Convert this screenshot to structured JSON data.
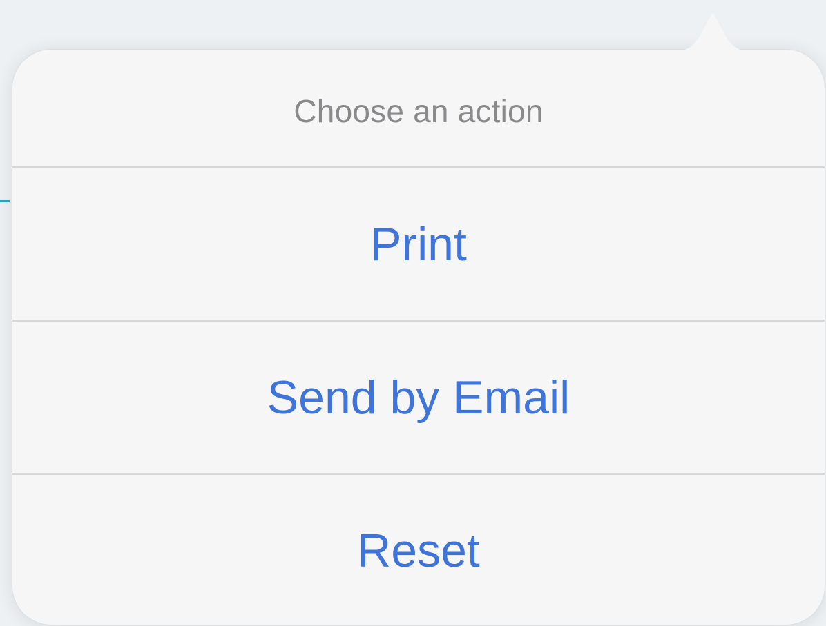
{
  "action_sheet": {
    "title": "Choose an action",
    "actions": [
      {
        "label": "Print"
      },
      {
        "label": "Send by Email"
      },
      {
        "label": "Reset"
      }
    ]
  },
  "colors": {
    "background": "#eef1f4",
    "popover_background": "#f6f6f7",
    "title_text": "#8a8a8d",
    "action_text": "#3f74db",
    "separator": "#d7d7da",
    "backdrop_accent": "#2aa0c8"
  }
}
